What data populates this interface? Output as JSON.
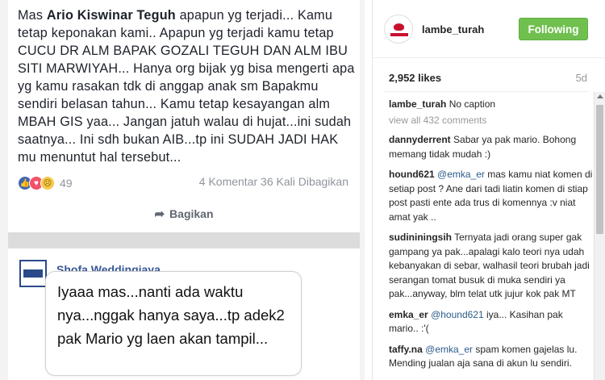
{
  "post_image": {
    "fb_post": {
      "text_prefix": "Mas ",
      "text_bold": "Ario Kiswinar Teguh",
      "text_rest": " apapun yg terjadi... Kamu tetap keponakan kami.. Apapun yg terjadi kamu tetap CUCU DR ALM BAPAK GOZALI TEGUH DAN ALM IBU SITI MARWIYAH... Hanya org bijak yg bisa mengerti apa yg kamu rasakan tdk di anggap anak sm Bapakmu sendiri belasan tahun... Kamu tetap kesayangan alm MBAH GIS yaa... Jangan jatuh walau di hujat...ini sudah saatnya... Ini sdh bukan AIB...tp ini SUDAH JADI HAK mu menuntut hal tersebut...",
      "reaction_count": "49",
      "stats": "4 Komentar 36 Kali Dibagikan",
      "share_label": "Bagikan"
    },
    "fb_comment": {
      "name": "Shofa Weddingjaya"
    },
    "bubble_text": "Iyaaa mas...nanti ada waktu nya...nggak hanya saya...tp adek2 pak Mario yg laen akan tampil..."
  },
  "instagram": {
    "username": "lambe_turah",
    "follow_label": "Following",
    "likes": "2,952 likes",
    "age": "5d",
    "caption_user": "lambe_turah",
    "caption_text": "No caption",
    "view_all": "view all 432 comments",
    "comments": [
      {
        "user": "dannyderrent",
        "mention": "",
        "text": "Sabar ya pak mario. Bohong memang tidak mudah :)"
      },
      {
        "user": "hound621",
        "mention": "@emka_er",
        "text": "mas kamu niat komen di setiap post ? Ane dari tadi liatin komen di stiap post pasti ente ada trus di komennya :v niat amat yak .."
      },
      {
        "user": "sudininingsih",
        "mention": "",
        "text": "Ternyata jadi orang super gak gampang ya pak...apalagi kalo teori nya udah kebanyakan di sebar, walhasil teori brubah jadi serangan tomat busuk di muka sendiri ya pak...anyway, blm telat utk jujur kok pak MT"
      },
      {
        "user": "emka_er",
        "mention": "@hound621",
        "text": "iya... Kasihan pak mario.. :'("
      },
      {
        "user": "taffy.na",
        "mention": "@emka_er",
        "text": "spam komen gajelas lu. Mending jualan aja sana di akun lu sendiri."
      }
    ],
    "colors": {
      "follow_bg": "#70c050",
      "mention": "#2b5c8a"
    }
  }
}
